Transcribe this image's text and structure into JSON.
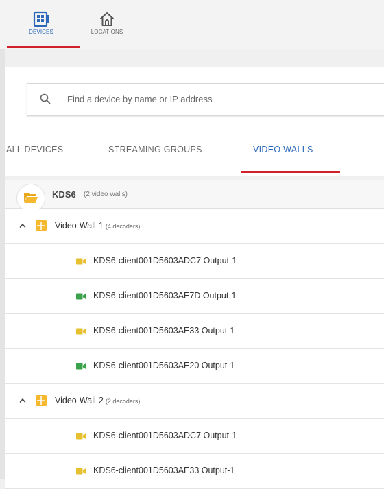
{
  "nav": {
    "devices_label": "DEVICES",
    "locations_label": "LOCATIONS",
    "active_color": "#2b68b8",
    "underline_color": "#d0202a"
  },
  "search": {
    "placeholder": "Find a device by name or IP address",
    "value": ""
  },
  "tabs": {
    "all": "ALL DEVICES",
    "streaming": "STREAMING GROUPS",
    "walls": "VIDEO WALLS",
    "active": "VIDEO WALLS"
  },
  "group": {
    "name": "KDS6",
    "count": "(2 video walls)",
    "icon": "folder-icon",
    "icon_color": "#f5b82e"
  },
  "walls": [
    {
      "name": "Video-Wall-1",
      "count": "(4 decoders)",
      "expanded": true,
      "icon": "grid-icon",
      "decoders": [
        {
          "name": "KDS6-client001D5603ADC7 Output-1",
          "status": "yellow",
          "color": "#e6c02e"
        },
        {
          "name": "KDS6-client001D5603AE7D Output-1",
          "status": "green",
          "color": "#3aa24a"
        },
        {
          "name": "KDS6-client001D5603AE33 Output-1",
          "status": "yellow",
          "color": "#e6c02e"
        },
        {
          "name": "KDS6-client001D5603AE20 Output-1",
          "status": "green",
          "color": "#3aa24a"
        }
      ]
    },
    {
      "name": "Video-Wall-2",
      "count": "(2 decoders)",
      "expanded": true,
      "icon": "grid-icon",
      "decoders": [
        {
          "name": "KDS6-client001D5603ADC7 Output-1",
          "status": "yellow",
          "color": "#e6c02e"
        },
        {
          "name": "KDS6-client001D5603AE33 Output-1",
          "status": "yellow",
          "color": "#e6c02e"
        }
      ]
    }
  ]
}
